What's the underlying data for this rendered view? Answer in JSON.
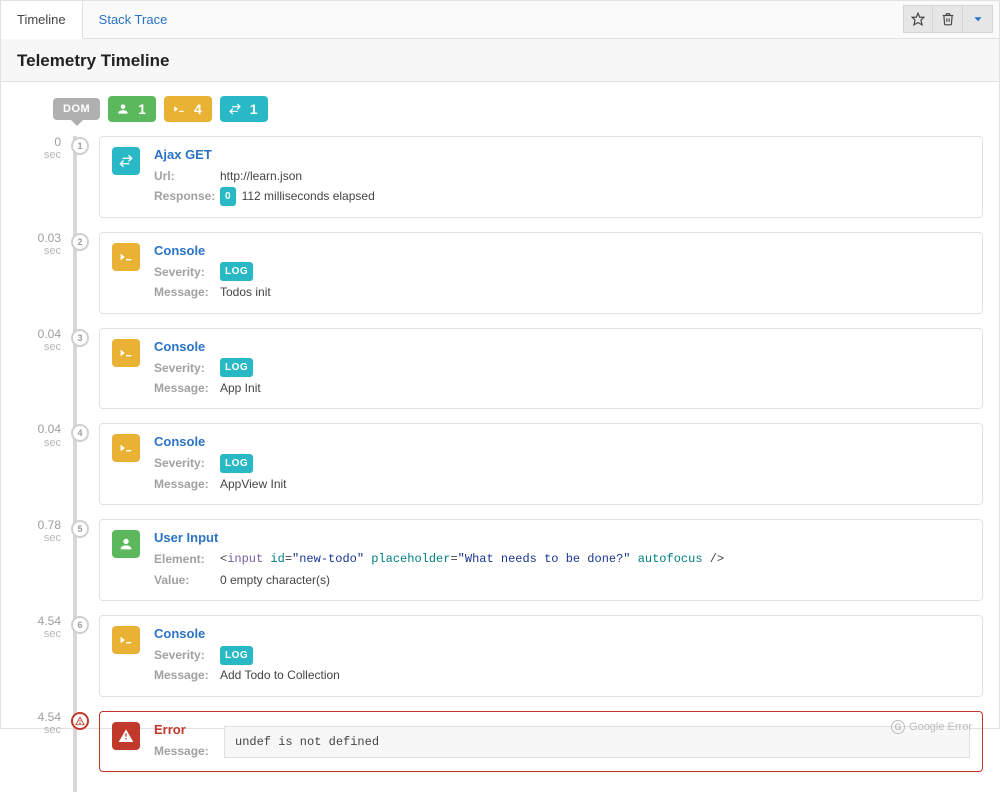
{
  "tabs": {
    "timeline": "Timeline",
    "stacktrace": "Stack Trace"
  },
  "header": {
    "title": "Telemetry Timeline"
  },
  "filters": {
    "dom_label": "DOM",
    "user_count": "1",
    "console_count": "4",
    "ajax_count": "1"
  },
  "sec_label": "sec",
  "events": [
    {
      "time": "0",
      "idx": "1",
      "type": "ajax",
      "title": "Ajax GET",
      "url_label": "Url:",
      "url": "http://learn.json",
      "response_label": "Response:",
      "response_code": "0",
      "response_text": "112 milliseconds elapsed"
    },
    {
      "time": "0.03",
      "idx": "2",
      "type": "console",
      "title": "Console",
      "severity_label": "Severity:",
      "severity": "LOG",
      "message_label": "Message:",
      "message": "Todos init"
    },
    {
      "time": "0.04",
      "idx": "3",
      "type": "console",
      "title": "Console",
      "severity_label": "Severity:",
      "severity": "LOG",
      "message_label": "Message:",
      "message": "App Init"
    },
    {
      "time": "0.04",
      "idx": "4",
      "type": "console",
      "title": "Console",
      "severity_label": "Severity:",
      "severity": "LOG",
      "message_label": "Message:",
      "message": "AppView Init"
    },
    {
      "time": "0.78",
      "idx": "5",
      "type": "user",
      "title": "User Input",
      "element_label": "Element:",
      "element_tag": "input",
      "element_attr_id": "id",
      "element_id": "\"new-todo\"",
      "element_attr_ph": "placeholder",
      "element_ph": "\"What needs to be done?\"",
      "element_attr_af": "autofocus",
      "value_label": "Value:",
      "value": "0 empty character(s)"
    },
    {
      "time": "4.54",
      "idx": "6",
      "type": "console",
      "title": "Console",
      "severity_label": "Severity:",
      "severity": "LOG",
      "message_label": "Message:",
      "message": "Add Todo to Collection"
    },
    {
      "time": "4.54",
      "idx": "!",
      "type": "error",
      "title": "Error",
      "message_label": "Message:",
      "message": "undef is not defined",
      "google_label": "Google Error"
    }
  ]
}
